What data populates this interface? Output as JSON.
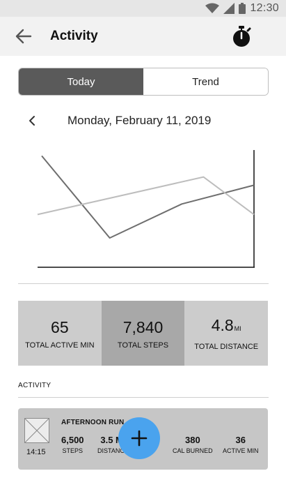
{
  "status_bar": {
    "time": "12:30",
    "icons": [
      "wifi-icon",
      "signal-icon",
      "battery-icon"
    ]
  },
  "app_bar": {
    "title": "Activity",
    "back_icon": "arrow-back-icon",
    "action_icon": "stopwatch-icon"
  },
  "tabs": [
    {
      "label": "Today",
      "active": true
    },
    {
      "label": "Trend",
      "active": false
    }
  ],
  "date_nav": {
    "date": "Monday, February 11, 2019",
    "prev_icon": "chevron-left-icon"
  },
  "chart_data": {
    "type": "line",
    "x": [
      0,
      1,
      2,
      3
    ],
    "series": [
      {
        "values": [
          95,
          25,
          54,
          70
        ],
        "color": "#6e6e6e"
      },
      {
        "values": [
          45,
          77,
          45
        ],
        "x": [
          0,
          2.3,
          3
        ],
        "color": "#bdbdbd"
      }
    ],
    "xlim": [
      0,
      3
    ],
    "ylim": [
      0,
      100
    ],
    "grid": false,
    "xlabel": "",
    "ylabel": ""
  },
  "stats": [
    {
      "value": "65",
      "unit": "",
      "label": "TOTAL ACTIVE MIN",
      "selected": false
    },
    {
      "value": "7,840",
      "unit": "",
      "label": "TOTAL STEPS",
      "selected": true
    },
    {
      "value": "4.8",
      "unit": "MI",
      "label": "TOTAL DISTANCE",
      "selected": false
    }
  ],
  "activity_section": {
    "label": "ACTIVITY"
  },
  "activity_card": {
    "title": "AFTERNOON RUN",
    "time": "14:15",
    "thumbnail_icon": "image-placeholder-icon",
    "metrics": [
      {
        "value": "6,500",
        "label": "STEPS"
      },
      {
        "value": "3.5 MI",
        "label": "DISTANCE"
      },
      {
        "value": "380",
        "label": "CAL BURNED"
      },
      {
        "value": "36",
        "label": "ACTIVE MIN"
      }
    ]
  },
  "fab": {
    "icon": "plus-icon",
    "color": "#4aa3ee"
  }
}
